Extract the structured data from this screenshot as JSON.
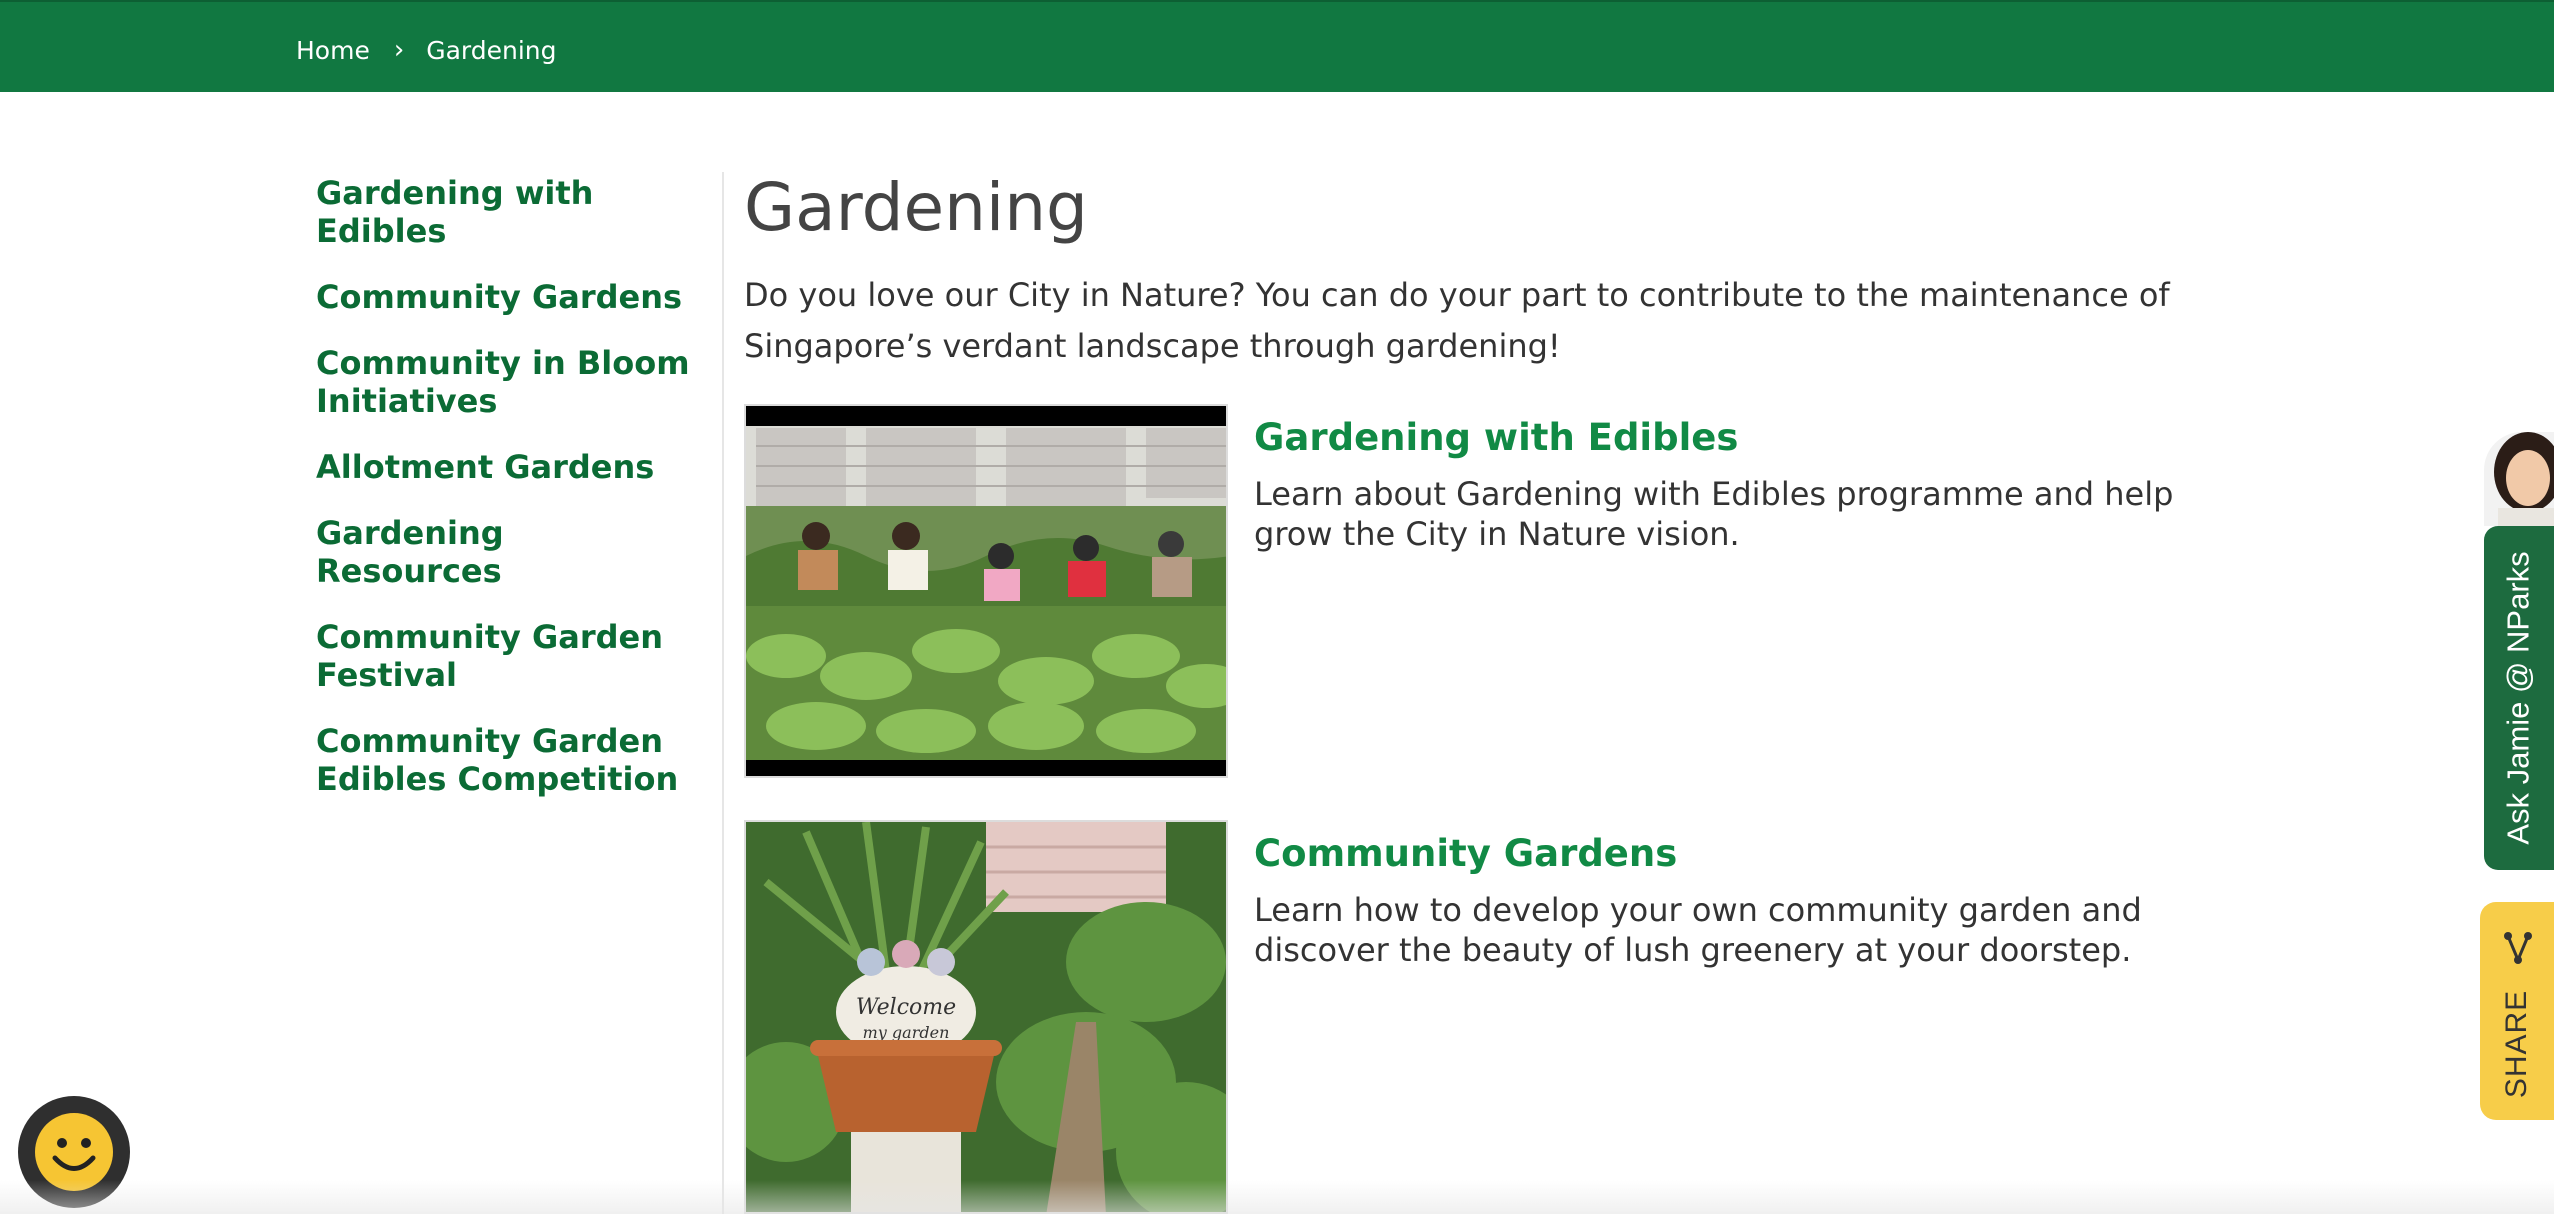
{
  "breadcrumb": {
    "home": "Home",
    "separator": "›",
    "current": "Gardening"
  },
  "sidebar": {
    "items": [
      {
        "label": "Gardening with Edibles"
      },
      {
        "label": "Community Gardens"
      },
      {
        "label": "Community in Bloom Initiatives"
      },
      {
        "label": "Allotment Gardens"
      },
      {
        "label": "Gardening Resources"
      },
      {
        "label": "Community Garden Festival"
      },
      {
        "label": "Community Garden Edibles Competition"
      }
    ]
  },
  "main": {
    "title": "Gardening",
    "intro": "Do you love our City in Nature? You can do your part to contribute to the maintenance of Singapore’s verdant landscape through gardening!",
    "cards": [
      {
        "title": "Gardening with Edibles",
        "description": "Learn about Gardening with Edibles programme and help grow the City in Nature vision.",
        "image": "people-in-vegetable-garden-photo"
      },
      {
        "title": "Community Gardens",
        "description": "Learn how to develop your own community garden and discover the beauty of lush greenery at your doorstep.",
        "image": "welcome-to-my-garden-pot-photo"
      }
    ]
  },
  "jamie": {
    "label": "Ask Jamie @ NParks"
  },
  "share": {
    "label": "SHARE",
    "icon": "share-icon"
  },
  "feedback": {
    "icon": "smiley-icon"
  },
  "colors": {
    "topbar": "#117841",
    "nav_link": "#0b6b35",
    "card_title": "#118a45",
    "jamie_tab": "#1d6b3f",
    "share_tab": "#f7cd49"
  }
}
